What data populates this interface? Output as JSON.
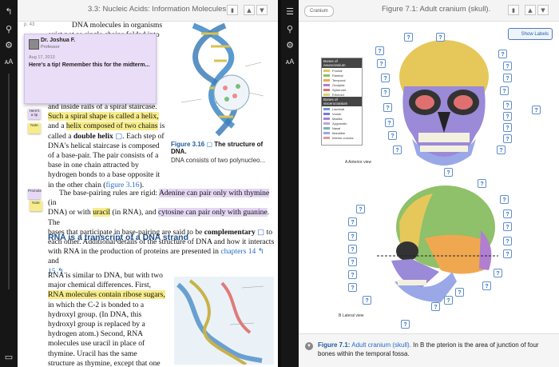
{
  "left_page": {
    "title": "3.3: Nucleic Acids: Information Molecules",
    "page_number": "p. 43",
    "note": {
      "author": "Dr. Joshua F.",
      "role": "Professor",
      "date": "Aug 17, 2013",
      "text": "Here's a tip! Remember this for the midterm..."
    },
    "sticky1": "Here's a tip",
    "sticky2": "Note",
    "sticky3": "Promote",
    "sticky4": "Note",
    "para1": {
      "l1": "DNA molecules in organisms",
      "l2": "exist not as single chains folded into",
      "l3": "and inside rails of a spiral staircase.",
      "l4": "Such a spiral shape is called a helix,",
      "l5_a": "and a ",
      "l5_b": "helix composed of two chains",
      "l5_c": " is",
      "l6_a": "called a ",
      "l6_b": "double helix",
      "l6_c": ". Each step of",
      "l7": "DNA's helical staircase is composed",
      "l8": "of a base-pair. The pair consists of a",
      "l9": "base in one chain attracted by",
      "l10": "hydrogen bonds to a base opposite it",
      "l11_a": "in the other chain (",
      "l11_b": "figure 3.16",
      "l11_c": ")."
    },
    "para2": {
      "l1_a": "The base-pairing rules are rigid: ",
      "l1_b": "Adenine can pair only with thymine",
      "l1_c": " (in",
      "l2_a": "DNA) or with ",
      "l2_b": "uracil",
      "l2_c": " (in RNA), and ",
      "l2_d": "cytosine can pair only with guanine",
      "l2_e": ". The",
      "l3_a": "bases that participate in base-pairing are said to be ",
      "l3_b": "complementary",
      "l3_c": " to",
      "l4": "each other. Additional details of the structure of DNA and how it interacts",
      "l5_a": "with RNA in the production of proteins are presented in ",
      "l5_b": "chapters 14",
      "l5_c": " and",
      "l6": "15"
    },
    "figure": {
      "label": "Figure 3.16",
      "title": "The structure of DNA.",
      "desc": "DNA consists of two polynucleo..."
    },
    "heading": "RNA is a transcript of a DNA strand",
    "para3": {
      "l1": "RNA is similar to DNA, but with two",
      "l2": "major chemical differences. First,",
      "l3": "RNA molecules contain ribose sugars,",
      "l4": "in which the C-2 is bonded to a",
      "l5": "hydroxyl group. (In DNA, this",
      "l6": "hydroxyl group is replaced by a",
      "l7": "hydrogen atom.) Second, RNA",
      "l8": "molecules use uracil in place of",
      "l9": "thymine. Uracil has the same",
      "l10": "structure as thymine, except that one"
    }
  },
  "right_page": {
    "title": "Figure 7.1: Adult cranium (skull).",
    "breadcrumb": "Cranium",
    "show_labels": "Show Labels",
    "legend": {
      "header1": "Bones of neurocranium",
      "bones1": [
        "Frontal",
        "Parietal",
        "Temporal",
        "Occipital",
        "Sphenoid",
        "Ethmoid"
      ],
      "header2": "Bones of viscerocranium",
      "bones2": [
        "Lacrimal",
        "Vomer",
        "Maxilla",
        "Zygomatic",
        "Nasal",
        "Mandible",
        "Inferior concha"
      ]
    },
    "view_a": "A  Anterior view",
    "view_b": "B  Lateral view",
    "caption": {
      "label": "Figure 7.1:",
      "title": "Adult cranium (skull).",
      "text": "In B the pterion is the area of junction of four bones within the temporal fossa."
    },
    "q_mark": "?"
  },
  "colors": {
    "frontal": "#e6c85a",
    "parietal": "#8fc06a",
    "temporal": "#f0a850",
    "occipital": "#b07fd0",
    "sphenoid": "#e07070",
    "ethmoid": "#d8d070",
    "maxilla": "#9a8ad8",
    "mandible": "#9aa8e8",
    "highlight_yellow": "#f7ec8a",
    "highlight_purple": "#e4d6f4",
    "link": "#2a6cc7"
  }
}
